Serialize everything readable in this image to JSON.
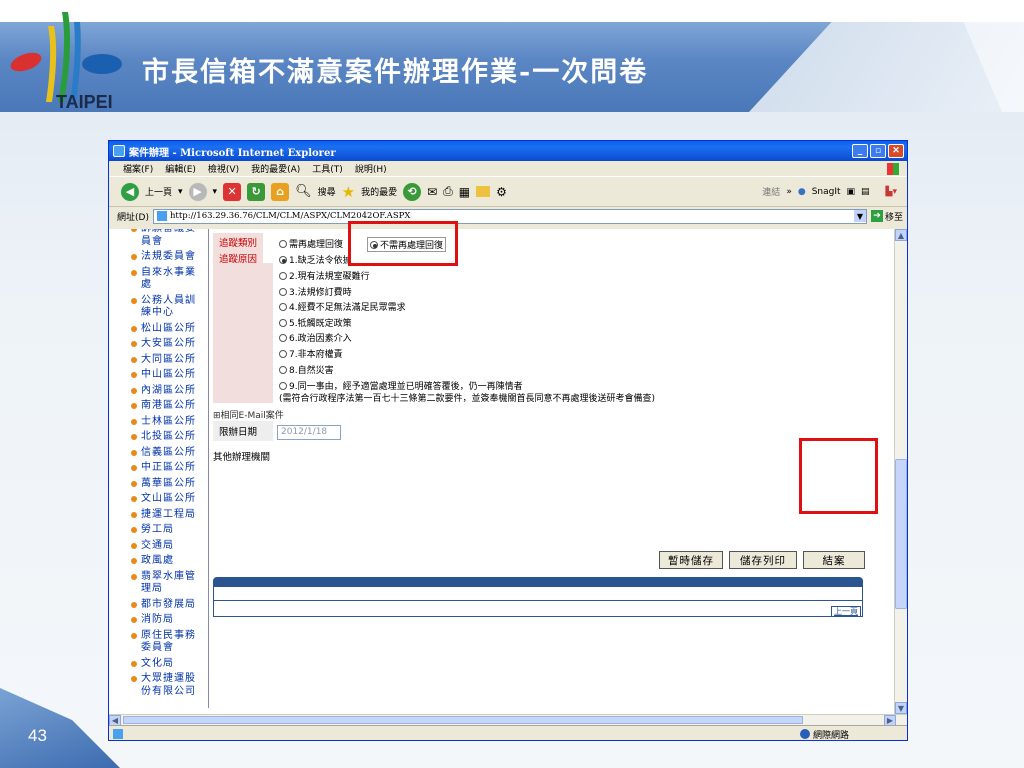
{
  "slide": {
    "title": "市長信箱不滿意案件辦理作業-一次問卷",
    "logo_text": "TAIPEI",
    "page_number": "43"
  },
  "window": {
    "title": "案件辦理 - Microsoft Internet Explorer",
    "menu": [
      "檔案(F)",
      "編輯(E)",
      "檢視(V)",
      "我的最愛(A)",
      "工具(T)",
      "說明(H)"
    ],
    "toolbar": {
      "back": "上一頁",
      "search": "搜尋",
      "favorites": "我的最愛",
      "links": "連結",
      "snagit": "SnagIt"
    },
    "address_label": "網址(D)",
    "address_value": "http://163.29.36.76/CLM/CLM/ASPX/CLM2042OF.ASPX",
    "go_label": "移至",
    "status_zone": "網際網路"
  },
  "nav_items": [
    "訴願審議委員會",
    "法規委員會",
    "自來水事業處",
    "公務人員訓練中心",
    "松山區公所",
    "大安區公所",
    "大同區公所",
    "中山區公所",
    "內湖區公所",
    "南港區公所",
    "士林區公所",
    "北投區公所",
    "信義區公所",
    "中正區公所",
    "萬華區公所",
    "文山區公所",
    "捷運工程局",
    "勞工局",
    "交通局",
    "政風處",
    "翡翠水庫管理局",
    "都市發展局",
    "消防局",
    "原住民事務委員會",
    "文化局",
    "大眾捷運股份有限公司"
  ],
  "form": {
    "track_type_label": "追蹤類別",
    "track_type_options": [
      "需再處理回復",
      "不需再處理回復"
    ],
    "track_type_selected": "不需再處理回復",
    "track_reason_label": "追蹤原因",
    "track_reasons": [
      "1.缺乏法令依據",
      "2.現有法規室礙難行",
      "3.法規修訂費時",
      "4.經費不足無法滿足民眾需求",
      "5.牴觸既定政策",
      "6.政治因素介入",
      "7.非本府權責",
      "8.自然災害",
      "9.同一事由，經予適當處理並已明確答覆後，仍一再陳情者"
    ],
    "track_reason_note": "(需符合行政程序法第一百七十三條第二款要件，並簽奉機關首長同意不再處理後送研考會備查)",
    "email_case_label": "⊞相同E-Mail案件",
    "deadline_label": "限辦日期",
    "deadline_value": "2012/1/18",
    "other_agencies_label": "其他辦理機關",
    "buttons": {
      "temp_save": "暫時儲存",
      "save_print": "儲存列印",
      "close_case": "結案"
    },
    "bottom_link": "上一頁"
  },
  "colors": {
    "highlight_box": "#e01010",
    "label_bg": "#f3dede",
    "label_text": "#cc0000",
    "xp_title": "#0a5fe8"
  }
}
